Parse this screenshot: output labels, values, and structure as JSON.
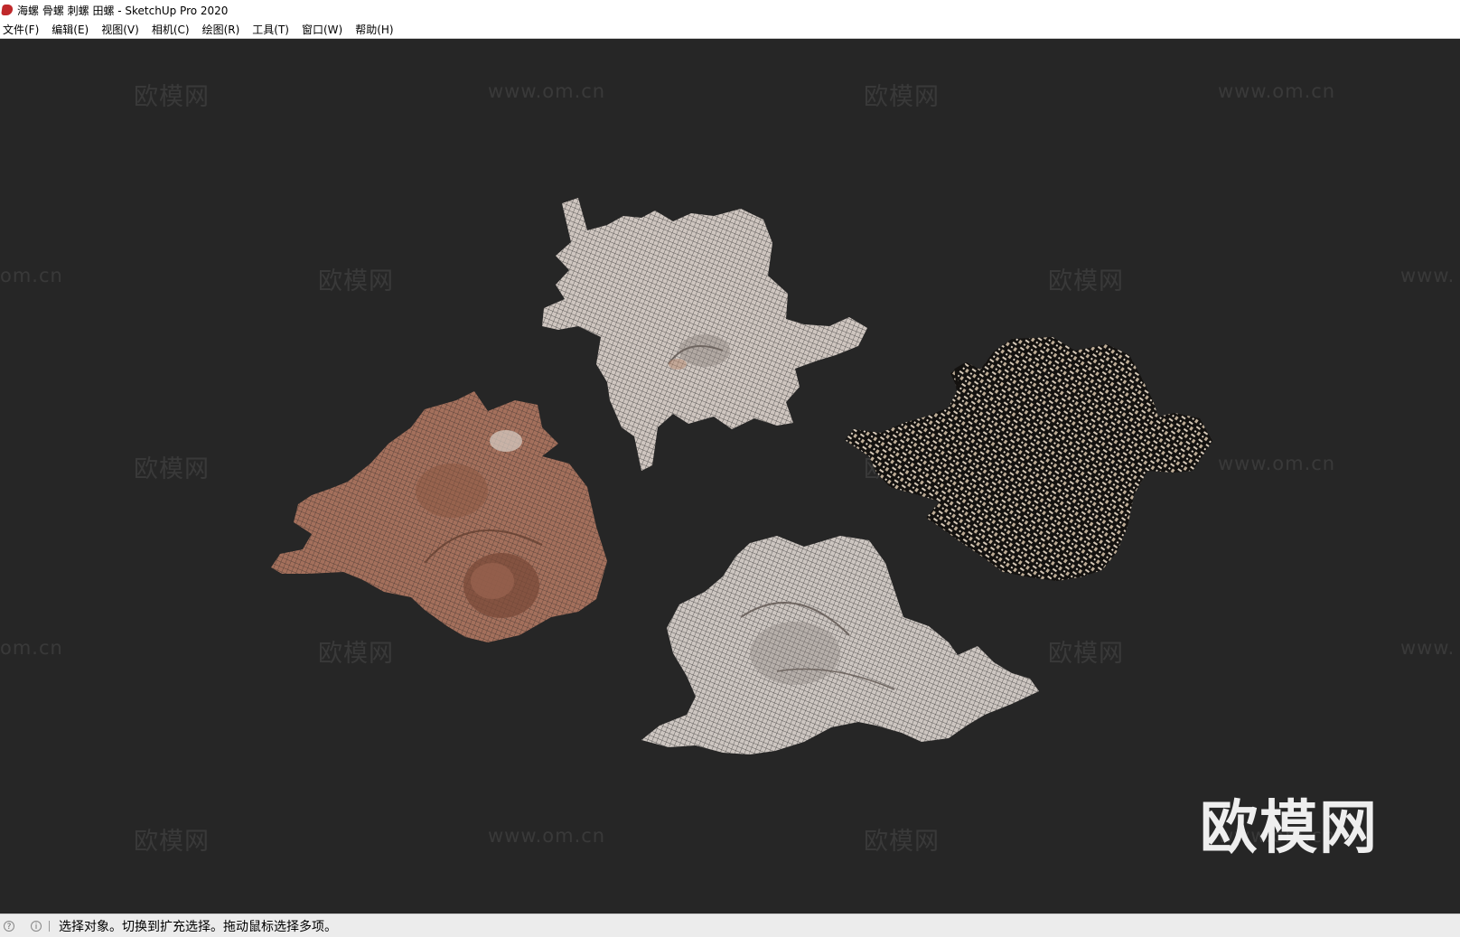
{
  "window": {
    "title": "海螺 骨螺 刺螺 田螺 - SketchUp Pro 2020",
    "app_icon": "sketchup-icon"
  },
  "menu": [
    "文件(F)",
    "编辑(E)",
    "视图(V)",
    "相机(C)",
    "绘图(R)",
    "工具(T)",
    "窗口(W)",
    "帮助(H)"
  ],
  "viewport": {
    "background": "#262626",
    "watermark_logo": "欧模网",
    "watermark_url": "www.om.cn",
    "watermark_url_partial_left": "om.cn",
    "watermark_url_partial_right": "www."
  },
  "models": [
    {
      "name": "shell-white-top",
      "color": "#cfc6c0"
    },
    {
      "name": "shell-brown-left",
      "color": "#a4705c"
    },
    {
      "name": "shell-dark-right",
      "color": "#4a4038"
    },
    {
      "name": "shell-white-bottom",
      "color": "#cdc6c1"
    }
  ],
  "status": {
    "icons": [
      "help-icon",
      "info-icon"
    ],
    "text": "选择对象。切换到扩充选择。拖动鼠标选择多项。"
  }
}
